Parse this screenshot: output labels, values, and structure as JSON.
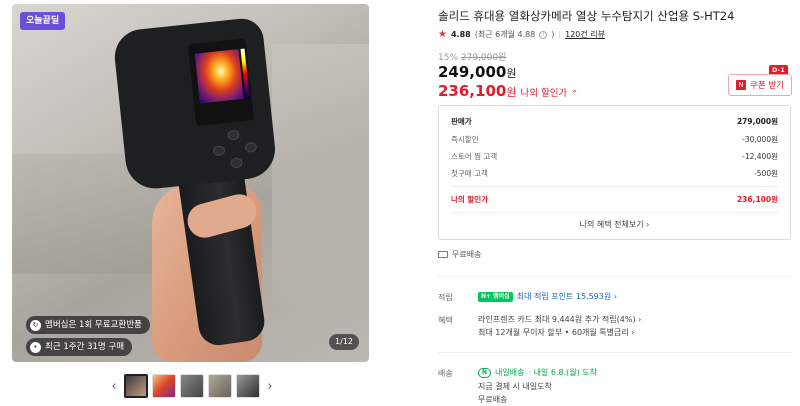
{
  "gallery": {
    "today_badge": "오늘끝딜",
    "chips": [
      {
        "icon": "refresh-icon",
        "text": "멤버십은 1회 무료교환반품"
      },
      {
        "icon": "cart-icon",
        "text": "최근 1주간 31명 구매"
      }
    ],
    "page_indicator": "1/12",
    "thumbnails": [
      "thumb-1",
      "thumb-2",
      "thumb-3",
      "thumb-4",
      "thumb-5"
    ]
  },
  "product": {
    "title": "솔리드 휴대용 열화상카메라 열상 누수탐지기 산업용 S-HT24",
    "rating_score": "4.88",
    "rating_detail": "(최근 6개월 4.88",
    "rating_info_icon": "info-icon",
    "rating_close": ")",
    "review_link": "120건 리뷰",
    "discount_pct": "15%",
    "original_price": "279,000원",
    "price": "249,000",
    "price_unit": "원",
    "my_price": "236,100",
    "my_price_unit": "원",
    "my_price_label": "나의 할인가",
    "coupon_label": "쿠폰 받기",
    "dday": "D-1"
  },
  "breakdown": {
    "rows": [
      {
        "label": "판매가",
        "value": "279,000원"
      },
      {
        "label": "즉시할인",
        "value": "-30,000원"
      },
      {
        "label": "스토어 찜 고객",
        "value": "-12,400원"
      },
      {
        "label": "첫구매 고객",
        "value": "-500원"
      },
      {
        "label": "나의 할인가",
        "value": "236,100원"
      }
    ],
    "benefit_link": "나의 혜택 전체보기 ›"
  },
  "shipping_note": "무료배송",
  "points": {
    "label": "적립",
    "badge": "N+ 멤버십",
    "text": "최대 적립 포인트 15,593원 ›"
  },
  "benefit": {
    "label": "혜택",
    "line1": "라인프렌즈 카드 최대 9,444원 추가 적립(4%) ›",
    "line2": "최대 12개월 무이자 할부 • 60개월 특별금리 ›"
  },
  "delivery": {
    "label": "배송",
    "badge": "N",
    "type": "내일배송",
    "eta": "· 내일 6.8.(월) 도착",
    "line2": "지금 결제 시 내일도착",
    "line3": "무료배송"
  }
}
